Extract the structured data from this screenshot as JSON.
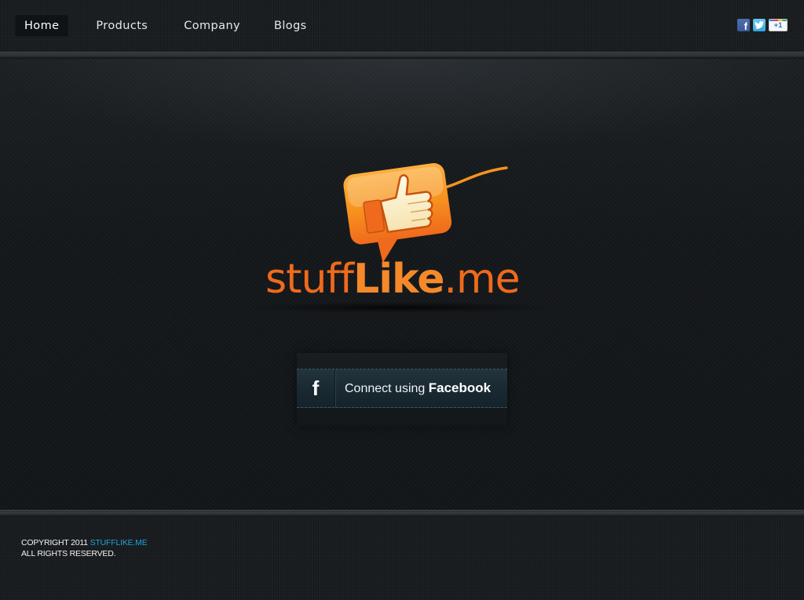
{
  "nav": {
    "items": [
      {
        "label": "Home",
        "active": true
      },
      {
        "label": "Products",
        "active": false
      },
      {
        "label": "Company",
        "active": false
      },
      {
        "label": "Blogs",
        "active": false
      }
    ]
  },
  "social": {
    "facebook_glyph": "f",
    "google_plus_label": "+1",
    "icons": [
      "facebook-icon",
      "twitter-icon",
      "google-plus-one-icon"
    ]
  },
  "logo": {
    "part1": "stuff",
    "part2": "Like",
    "part3": ".me",
    "colors": {
      "primary": "#ef6a1c",
      "accent": "#f5892a",
      "bubble": "#f7931e"
    }
  },
  "connect": {
    "icon_glyph": "f",
    "label_prefix": "Connect using ",
    "label_brand": "Facebook"
  },
  "footer": {
    "copyright": "COPYRIGHT 2011 ",
    "site": "STUFFLIKE.ME",
    "rights": "ALL RIGHTS RESERVED.",
    "link_color": "#1fa3d8"
  }
}
